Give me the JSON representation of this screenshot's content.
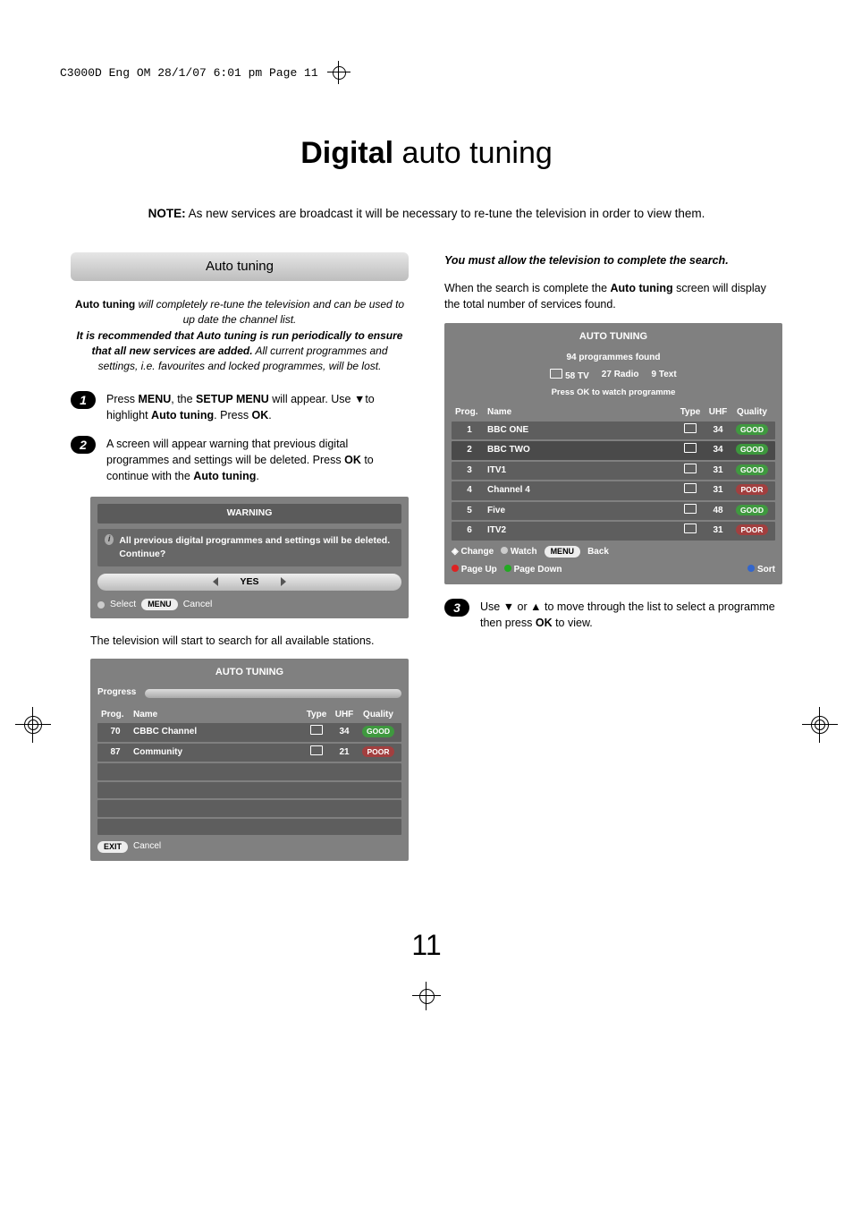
{
  "printmark": "C3000D Eng OM  28/1/07  6:01 pm  Page 11",
  "title_bold": "Digital",
  "title_rest": " auto tuning",
  "note_label": "NOTE:",
  "note_text": " As new services are broadcast it will be necessary to re-tune the television in order to view them.",
  "section_header": "Auto tuning",
  "intro": {
    "line1a": "Auto tuning",
    "line1b": " will completely re-tune the television and can be used to up date the channel list.",
    "line2": "It is recommended that Auto tuning is run periodically to ensure that all new services are added.",
    "line3": " All current programmes and settings, i.e. favourites and locked programmes, will be lost."
  },
  "steps": {
    "s1_a": "Press ",
    "s1_b": "MENU",
    "s1_c": ", the ",
    "s1_d": "SETUP MENU",
    "s1_e": " will appear. Use ▼to highlight ",
    "s1_f": "Auto tuning",
    "s1_g": ". Press ",
    "s1_h": "OK",
    "s1_i": ".",
    "s2_a": "A screen will appear warning that previous digital programmes and settings will be deleted. Press ",
    "s2_b": "OK",
    "s2_c": " to continue with the ",
    "s2_d": "Auto tuning",
    "s2_e": ".",
    "s3_a": "Use ▼ or ▲ to move through the list to select a programme then press ",
    "s3_b": "OK",
    "s3_c": " to view."
  },
  "warning_panel": {
    "title": "WARNING",
    "body": "All previous digital programmes and settings will be deleted. Continue?",
    "yes": "YES",
    "select": "Select",
    "menu": "MENU",
    "cancel": "Cancel"
  },
  "after_warning": "The television will start to search for all available stations.",
  "scan_panel": {
    "title": "AUTO TUNING",
    "progress_label": "Progress",
    "head": {
      "prog": "Prog.",
      "name": "Name",
      "type": "Type",
      "uhf": "UHF",
      "quality": "Quality"
    },
    "rows": [
      {
        "prog": "70",
        "name": "CBBC Channel",
        "uhf": "34",
        "quality": "GOOD"
      },
      {
        "prog": "87",
        "name": "Community",
        "uhf": "21",
        "quality": "POOR"
      }
    ],
    "empty_rows": 4,
    "exit": "EXIT",
    "cancel": "Cancel"
  },
  "right_intro_bold": "You must allow the television to complete the search.",
  "right_para_a": "When the search is complete the ",
  "right_para_b": "Auto tuning",
  "right_para_c": " screen will display the total number of services found.",
  "result_panel": {
    "title": "AUTO TUNING",
    "found": "94 programmes found",
    "tv": "58 TV",
    "radio": "27 Radio",
    "text": "9  Text",
    "prompt": "Press OK to watch programme",
    "head": {
      "prog": "Prog.",
      "name": "Name",
      "type": "Type",
      "uhf": "UHF",
      "quality": "Quality"
    },
    "rows": [
      {
        "prog": "1",
        "name": "BBC ONE",
        "uhf": "34",
        "quality": "GOOD"
      },
      {
        "prog": "2",
        "name": "BBC TWO",
        "uhf": "34",
        "quality": "GOOD"
      },
      {
        "prog": "3",
        "name": "ITV1",
        "uhf": "31",
        "quality": "GOOD"
      },
      {
        "prog": "4",
        "name": "Channel 4",
        "uhf": "31",
        "quality": "POOR"
      },
      {
        "prog": "5",
        "name": "Five",
        "uhf": "48",
        "quality": "GOOD"
      },
      {
        "prog": "6",
        "name": "ITV2",
        "uhf": "31",
        "quality": "POOR"
      }
    ],
    "footer": {
      "change": "Change",
      "watch": "Watch",
      "menu": "MENU",
      "back": "Back",
      "pageup": "Page Up",
      "pagedown": "Page Down",
      "sort": "Sort"
    }
  },
  "page_number": "11"
}
